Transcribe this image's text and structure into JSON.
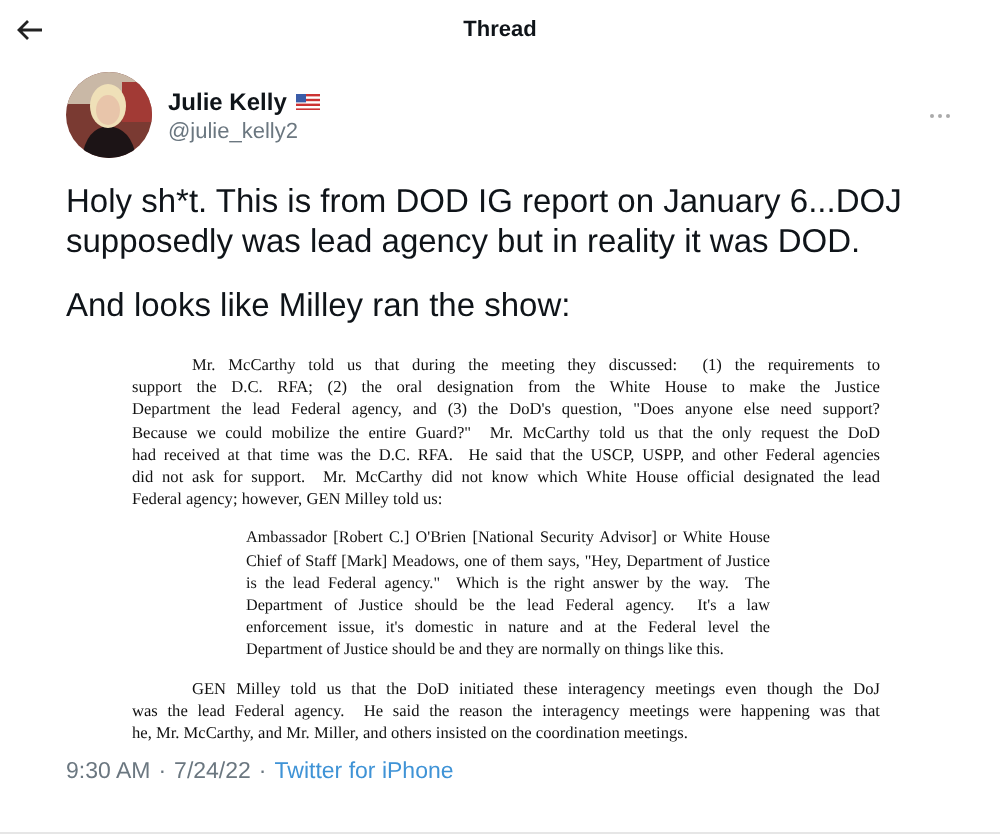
{
  "header": {
    "title": "Thread"
  },
  "author": {
    "name": "Julie Kelly",
    "handle": "@julie_kelly2"
  },
  "tweet": {
    "paragraphs": [
      "Holy sh*t. This is from DOD IG report on January 6...DOJ supposedly was lead agency but in reality it was DOD.",
      "And looks like Milley ran the show:"
    ]
  },
  "document": {
    "blocks": [
      {
        "kind": "paragraph",
        "lines": [
          "Mr. McCarthy told us that during the meeting they discussed:  (1) the requirements to",
          "support the D.C. RFA; (2) the oral designation from the White House to make the Justice",
          "Department the lead Federal agency, and (3) the DoD's question, \"Does anyone else need support?",
          "Because we could mobilize the entire Guard?\"  Mr. McCarthy told us that the only request the DoD",
          "had received at that time was the D.C. RFA.  He said that the USCP, USPP, and other Federal agencies",
          "did not ask for support.  Mr. McCarthy did not know which White House official designated the lead",
          "Federal agency; however, GEN Milley told us:"
        ]
      },
      {
        "kind": "quote",
        "lines": [
          "Ambassador [Robert C.] O'Brien [National Security Advisor] or White House",
          "Chief of Staff [Mark] Meadows, one of them says, \"Hey, Department of Justice",
          "is the lead Federal agency.\"  Which is the right answer by the way.  The",
          "Department of Justice should be the lead Federal agency.  It's a law",
          "enforcement issue, it's domestic in nature and at the Federal level the",
          "Department of Justice should be and they are normally on things like this."
        ]
      },
      {
        "kind": "paragraph",
        "lines": [
          "GEN Milley told us that the DoD initiated these interagency meetings even though the DoJ",
          "was the lead Federal agency.  He said the reason the interagency meetings were happening was that",
          "he, Mr. McCarthy, and Mr. Miller, and others insisted on the coordination meetings."
        ]
      }
    ]
  },
  "meta": {
    "time": "9:30 AM",
    "separator": "·",
    "date": "7/24/22",
    "source": "Twitter for iPhone"
  }
}
